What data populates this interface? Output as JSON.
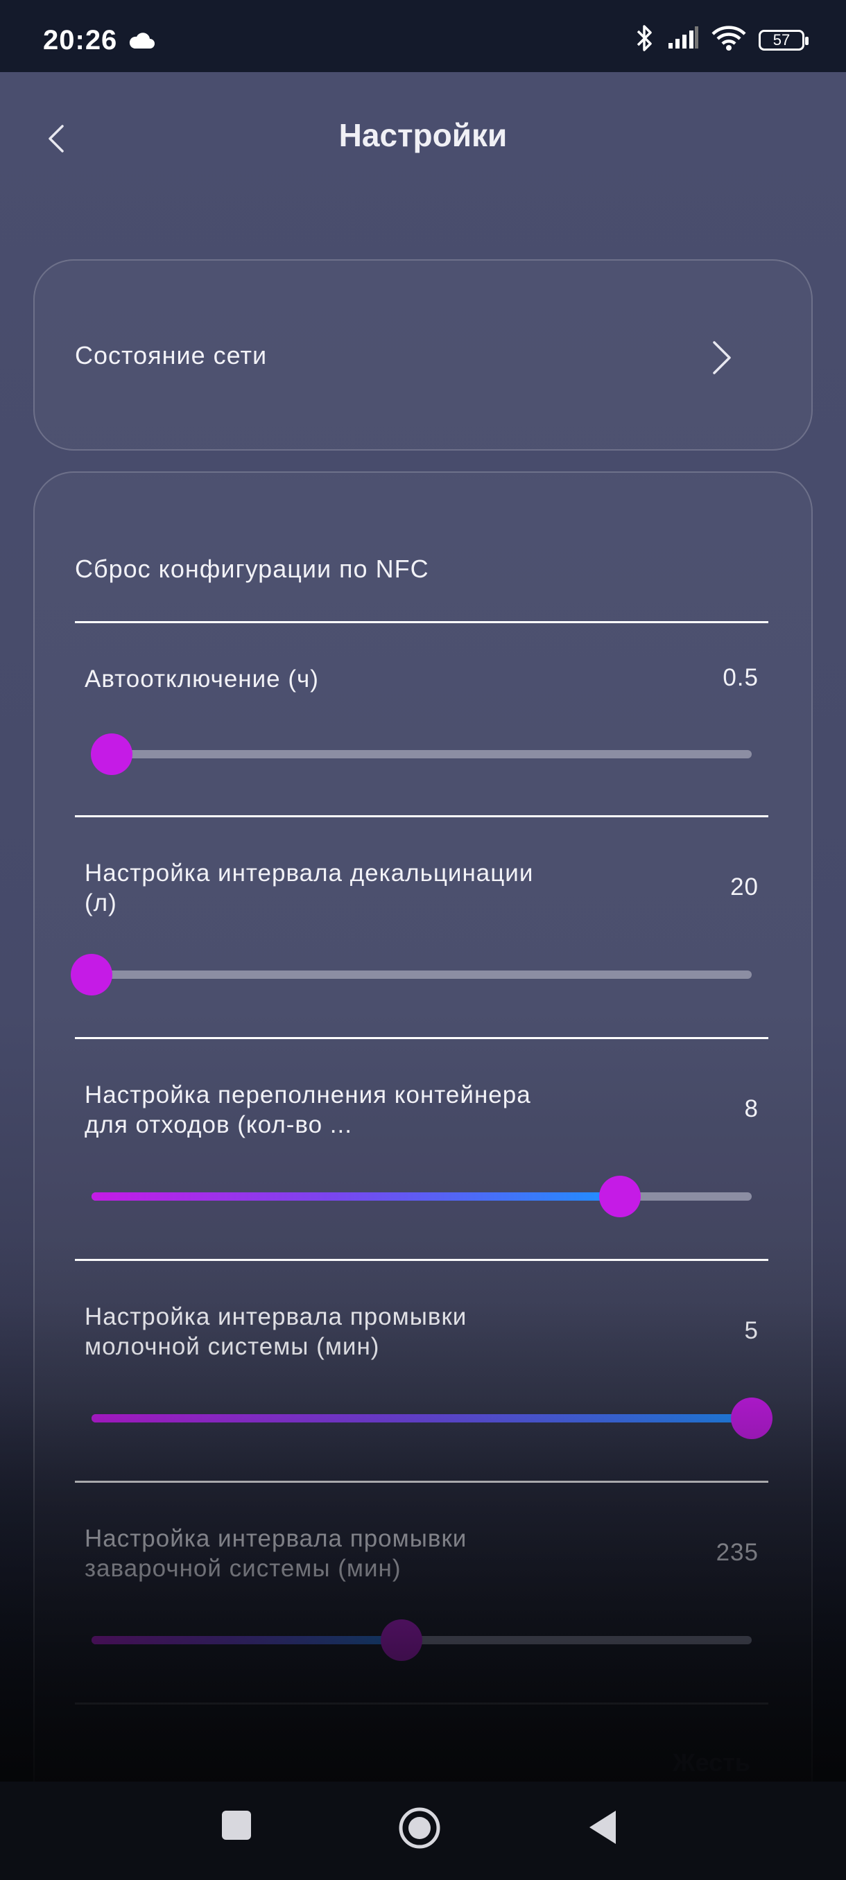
{
  "status_bar": {
    "time": "20:26",
    "battery": "57",
    "icons": [
      "cloud-icon",
      "bluetooth-icon",
      "signal-icon",
      "wifi-icon",
      "battery-icon"
    ]
  },
  "header": {
    "title": "Настройки",
    "back_icon": "chevron-left-icon"
  },
  "network_card": {
    "label": "Состояние сети",
    "icon": "chevron-right-icon"
  },
  "settings": {
    "nfc_label": "Сброс конфигурации по NFC",
    "sliders": [
      {
        "label": "Автоотключение (ч)",
        "value": "0.5",
        "fraction": 0.03
      },
      {
        "label": "Настройка интервала декальцинации (л)",
        "value": "20",
        "fraction": 0.0
      },
      {
        "label": "Настройка переполнения контейнера для отходов (кол-во ...",
        "value": "8",
        "fraction": 0.8
      },
      {
        "label": "Настройка интервала промывки молочной системы (мин)",
        "value": "5",
        "fraction": 1.0
      },
      {
        "label": "Настройка интервала промывки заварочной системы (мин)",
        "value": "235",
        "fraction": 0.47
      }
    ],
    "partial_text": "Жесть"
  },
  "colors": {
    "accent": "#c51be6",
    "gradient_mid": "#7b45ee",
    "gradient_end": "#1e90ff",
    "track": "#8c8ea3"
  },
  "nav_bar": {
    "icons": [
      "recents-square-icon",
      "home-circle-icon",
      "back-triangle-icon"
    ]
  }
}
